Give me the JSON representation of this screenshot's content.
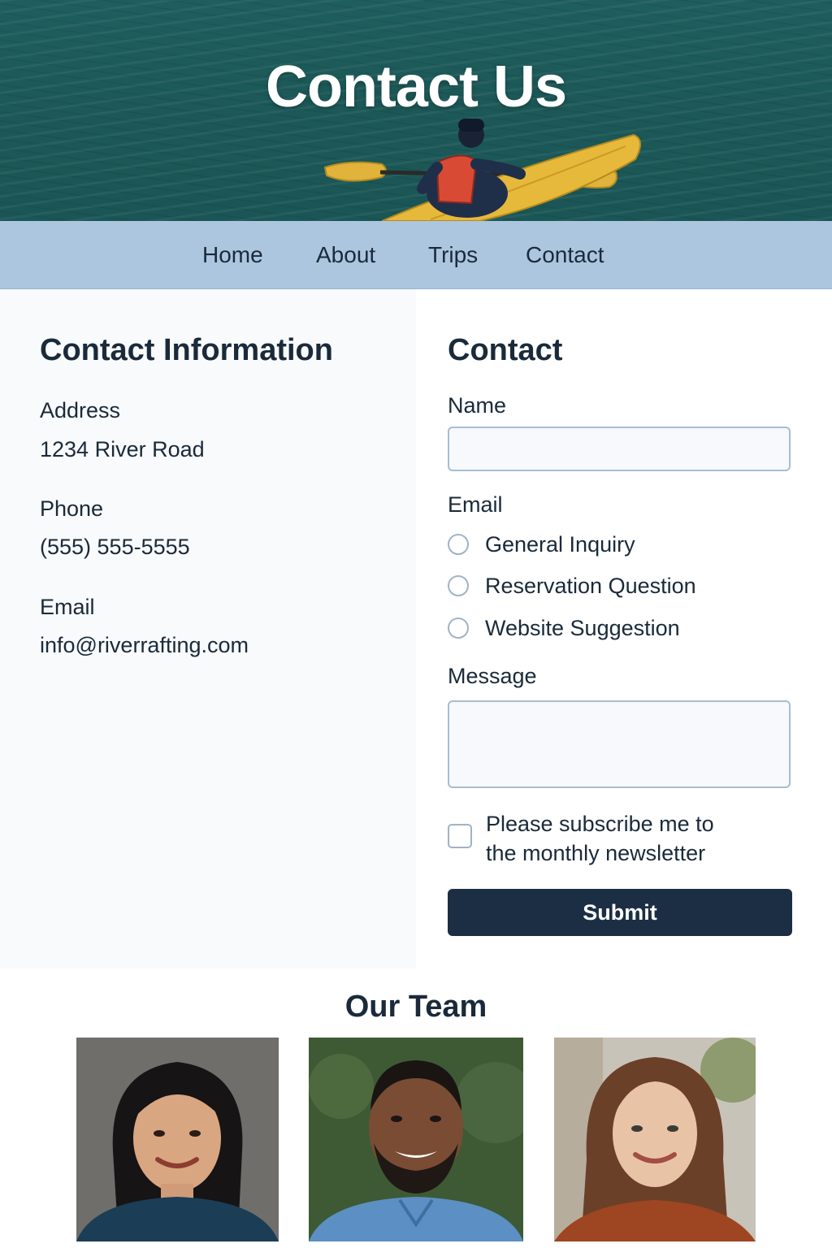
{
  "hero": {
    "title": "Contact Us"
  },
  "nav": {
    "items": [
      "Home",
      "About",
      "Trips",
      "Contact"
    ]
  },
  "contact_info": {
    "heading": "Contact Information",
    "address_label": "Address",
    "address_value": "1234 River Road",
    "phone_label": "Phone",
    "phone_value": "(555) 555-5555",
    "email_label": "Email",
    "email_value": "info@riverrafting.com"
  },
  "form": {
    "heading": "Contact",
    "name_label": "Name",
    "name_value": "",
    "email_label": "Email",
    "options": [
      "General Inquiry",
      "Reservation Question",
      "Website Suggestion"
    ],
    "message_label": "Message",
    "message_value": "",
    "newsletter_label": "Please subscribe me to the monthly newsletter",
    "newsletter_checked": false,
    "submit_label": "Submit"
  },
  "team": {
    "heading": "Our Team",
    "members": [
      "woman-dark-hair-avatar",
      "man-beard-avatar",
      "woman-auburn-hair-avatar"
    ]
  },
  "colors": {
    "hero_water": "#1c5958",
    "nav_bg": "#adc6df",
    "left_panel_bg": "#f8fafc",
    "submit_bg": "#1b2e44",
    "kayak": "#e7b93a",
    "life_vest": "#d94a35"
  }
}
